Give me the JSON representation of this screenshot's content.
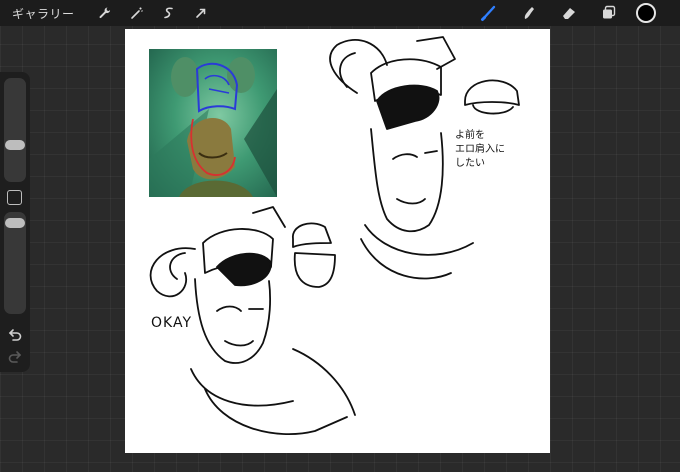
{
  "topbar": {
    "gallery_label": "ギャラリー",
    "left_icons": [
      "wrench-icon",
      "magic-wand-icon",
      "selection-icon",
      "transform-arrow-icon"
    ],
    "right_tools": [
      "brush-icon",
      "smudge-icon",
      "eraser-icon",
      "layers-icon"
    ],
    "current_color": "#000000",
    "accent": "#2f7fff"
  },
  "sidebar": {
    "brush_size_level": 0.25,
    "opacity_level": 0.05,
    "icons": [
      "undo-icon",
      "redo-icon"
    ]
  },
  "canvas": {
    "annotations": {
      "jp_note": [
        "よ前を",
        "エロ肩入に",
        "したい"
      ],
      "okay": "OKAY"
    }
  }
}
